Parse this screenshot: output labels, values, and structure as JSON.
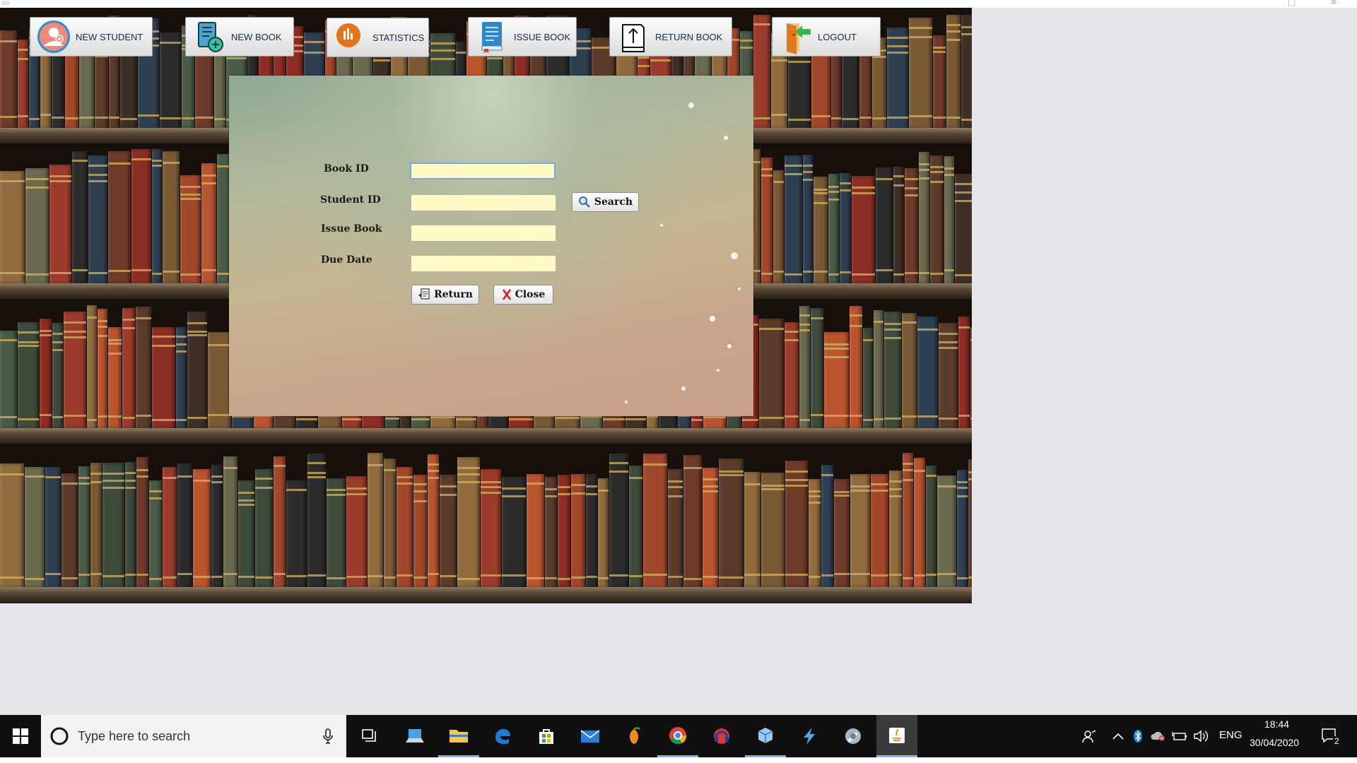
{
  "toolbar": {
    "new_student": "NEW STUDENT",
    "new_book": "NEW BOOK",
    "statistics": "STATISTICS",
    "issue_book": "ISSUE BOOK",
    "return_book": "RETURN BOOK",
    "logout": "LOGOUT"
  },
  "form": {
    "book_id_label": "Book ID",
    "book_id_value": "",
    "student_id_label": "Student ID",
    "student_id_value": "",
    "issue_book_label": "Issue Book",
    "issue_book_value": "",
    "due_date_label": "Due Date",
    "due_date_value": "",
    "search_button": "Search",
    "return_button": "Return",
    "close_button": "Close"
  },
  "taskbar": {
    "search_placeholder": "Type here to search",
    "language": "ENG",
    "time": "18:44",
    "date": "30/04/2020",
    "notification_count": "2",
    "apps": [
      "task-view-icon",
      "laptop-app-icon",
      "file-explorer-icon",
      "edge-icon",
      "store-icon",
      "mail-icon",
      "fruit-app-icon",
      "chrome-icon",
      "headset-app-icon",
      "cube-app-icon",
      "lightning-app-icon",
      "settings-app-icon",
      "java-app-icon"
    ]
  },
  "colors": {
    "input_background": "#fdfac6",
    "taskbar": "#101010",
    "desktop": "#e4e6ec"
  }
}
